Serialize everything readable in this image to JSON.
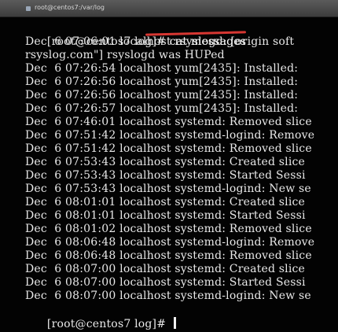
{
  "window": {
    "title": "root@centos7:/var/log"
  },
  "terminal": {
    "first_prompt": "[root@centos7 log]# ",
    "first_command": "cat messages",
    "lines": [
      "Dec  6 07:06:01 localhost rsyslogd: [origin soft",
      "rsyslog.com\"] rsyslogd was HUPed",
      "Dec  6 07:26:54 localhost yum[2435]: Installed:",
      "Dec  6 07:26:56 localhost yum[2435]: Installed:",
      "Dec  6 07:26:56 localhost yum[2435]: Installed:",
      "Dec  6 07:26:57 localhost yum[2435]: Installed:",
      "Dec  6 07:46:01 localhost systemd: Removed slice",
      "Dec  6 07:51:42 localhost systemd-logind: Remove",
      "Dec  6 07:51:42 localhost systemd: Removed slice",
      "Dec  6 07:53:43 localhost systemd: Created slice",
      "Dec  6 07:53:43 localhost systemd: Started Sessi",
      "Dec  6 07:53:43 localhost systemd-logind: New se",
      "Dec  6 08:01:01 localhost systemd: Created slice",
      "Dec  6 08:01:01 localhost systemd: Started Sessi",
      "Dec  6 08:01:02 localhost systemd: Removed slice",
      "Dec  6 08:06:48 localhost systemd-logind: Remove",
      "Dec  6 08:06:48 localhost systemd: Removed slice",
      "Dec  6 08:07:00 localhost systemd: Created slice",
      "Dec  6 08:07:00 localhost systemd: Started Sessi",
      "Dec  6 08:07:00 localhost systemd-logind: New se"
    ],
    "last_prompt": "[root@centos7 log]# "
  },
  "colors": {
    "terminal_background": "#030303",
    "terminal_text": "#e9e9e9",
    "annotation_underline": "#e33a35"
  }
}
